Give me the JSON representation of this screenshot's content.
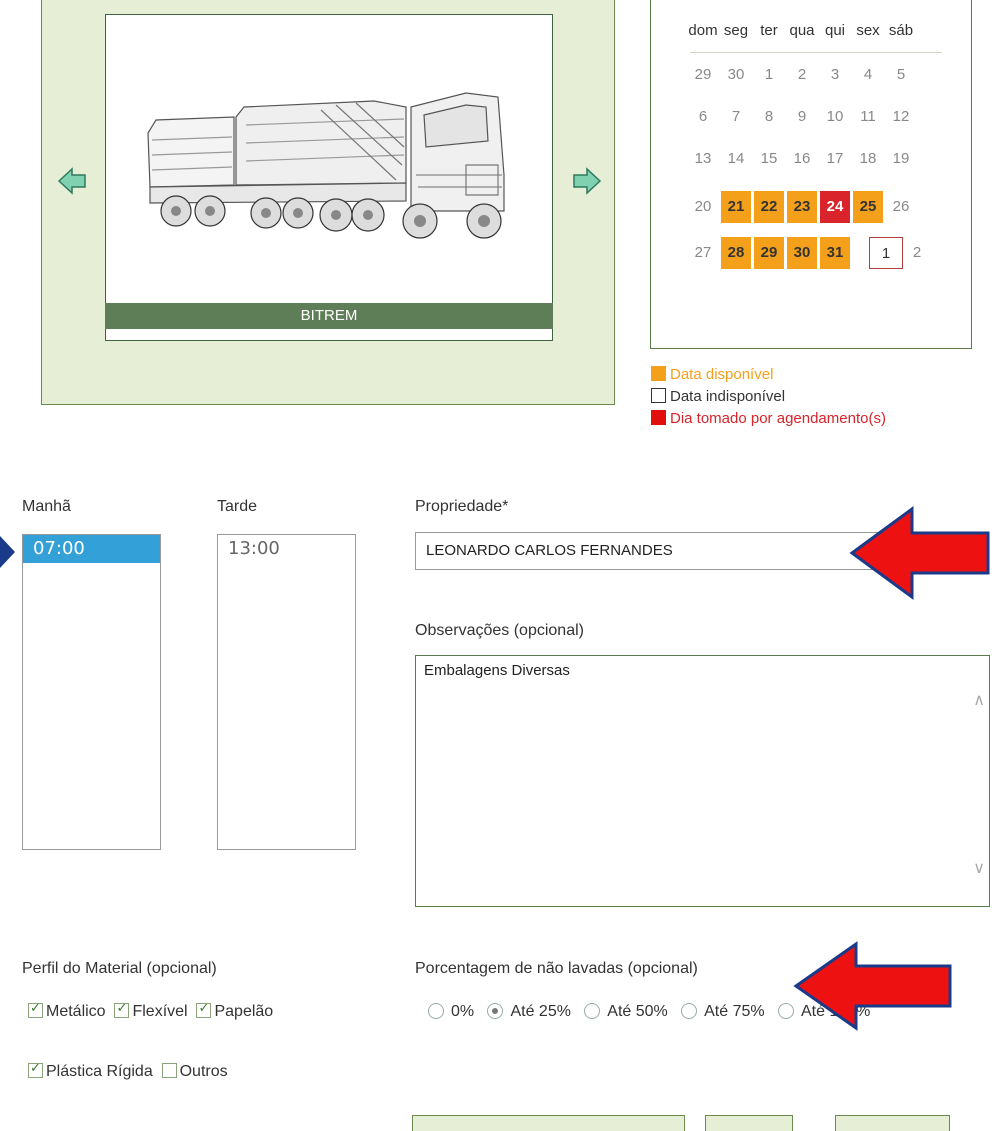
{
  "vehicle": {
    "name": "BITREM"
  },
  "calendar": {
    "weekdays": [
      "dom",
      "seg",
      "ter",
      "qua",
      "qui",
      "sex",
      "sáb"
    ],
    "colors": {
      "available": "#f5a01a",
      "taken": "#d8242a"
    }
  },
  "legend": {
    "available": "Data disponível",
    "unavailable": "Data indisponível",
    "taken": "Dia tomado por agendamento(s)"
  },
  "schedule": {
    "morning_label": "Manhã",
    "morning_slots": [
      "07:00"
    ],
    "afternoon_label": "Tarde",
    "afternoon_slots": [
      "13:00"
    ]
  },
  "form": {
    "property_label": "Propriedade*",
    "property_value": "LEONARDO CARLOS FERNANDES",
    "notes_label": "Observações (opcional)",
    "notes_value": "Embalagens Diversas",
    "material_label": "Perfil do Material (opcional)",
    "materials": [
      {
        "label": "Metálico",
        "checked": true
      },
      {
        "label": "Flexível",
        "checked": true
      },
      {
        "label": "Papelão",
        "checked": true
      },
      {
        "label": "Plástica Rígida",
        "checked": true
      },
      {
        "label": "Outros",
        "checked": false
      }
    ],
    "unwashed_label": "Porcentagem de não lavadas (opcional)",
    "unwashed_options": [
      {
        "label": "0%",
        "selected": false
      },
      {
        "label": "Até 25%",
        "selected": true
      },
      {
        "label": "Até 50%",
        "selected": false
      },
      {
        "label": "Até 75%",
        "selected": false
      },
      {
        "label": "Até 100%",
        "selected": false
      }
    ]
  },
  "annotations": {
    "arrow_color": "#ee1111"
  }
}
